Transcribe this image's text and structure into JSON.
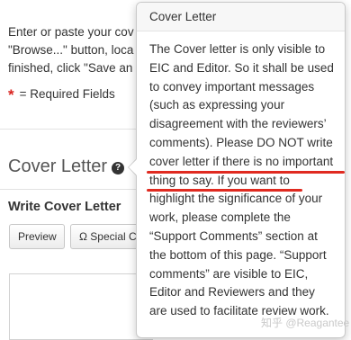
{
  "background": {
    "intro_lines": [
      "Enter or paste your cov",
      "\"Browse...\" button, loca",
      "finished, click \"Save an"
    ],
    "required_star": "*",
    "required_label": "= Required Fields",
    "section_title": "Cover Letter",
    "help_icon": "?",
    "write_label": "Write Cover Letter",
    "buttons": {
      "preview": "Preview",
      "special": "Ω Special C"
    }
  },
  "popover": {
    "title": "Cover Letter",
    "body_before": "The Cover letter is only visible to EIC and Editor. So it shall be used to convey important messages (such as expressing your disagreement with the reviewers’ comments). Please ",
    "body_highlight": "DO NOT write cover letter if there is no important thing to say",
    "body_after": ". If you want to highlight the significance of your work, please complete the “Support Comments” section at the bottom of this page. “Support comments” are visible to EIC, Editor and Reviewers and they are used to facilitate review work."
  },
  "watermark": "知乎 @Reagantee",
  "colors": {
    "accent_red": "#e02a20",
    "required_red": "#d9231f"
  }
}
